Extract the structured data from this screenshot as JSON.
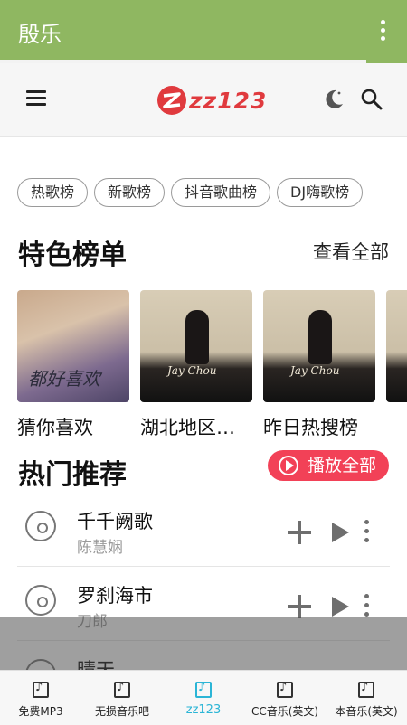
{
  "window": {
    "title": "殷乐"
  },
  "appbar": {
    "logo_text": "zz123",
    "brand_color": "#e03a3e"
  },
  "chips": [
    "热歌榜",
    "新歌榜",
    "抖音歌曲榜",
    "DJ嗨歌榜"
  ],
  "featured": {
    "heading": "特色榜单",
    "view_all": "查看全部",
    "cards": [
      {
        "caption": "猜你喜欢",
        "cover_text": "都好喜欢"
      },
      {
        "caption": "湖北地区…",
        "cover_text": "Jay Chou"
      },
      {
        "caption": "昨日热搜榜",
        "cover_text": "Jay Chou"
      }
    ]
  },
  "hot": {
    "heading": "热门推荐",
    "play_all": "播放全部",
    "songs": [
      {
        "title": "千千阙歌",
        "artist": "陈慧娴"
      },
      {
        "title": "罗刹海市",
        "artist": "刀郎"
      },
      {
        "title": "晴天",
        "artist": ""
      }
    ]
  },
  "bottom_nav": {
    "tabs": [
      {
        "label": "免费MP3",
        "active": false
      },
      {
        "label": "无损音乐吧",
        "active": false
      },
      {
        "label": "zz123",
        "active": true
      },
      {
        "label": "CC音乐(英文)",
        "active": false
      },
      {
        "label": "本音乐(英文)",
        "active": false
      }
    ]
  },
  "colors": {
    "title_bar": "#8fb761",
    "accent": "#f24157",
    "active_tab": "#2bb5d6"
  }
}
